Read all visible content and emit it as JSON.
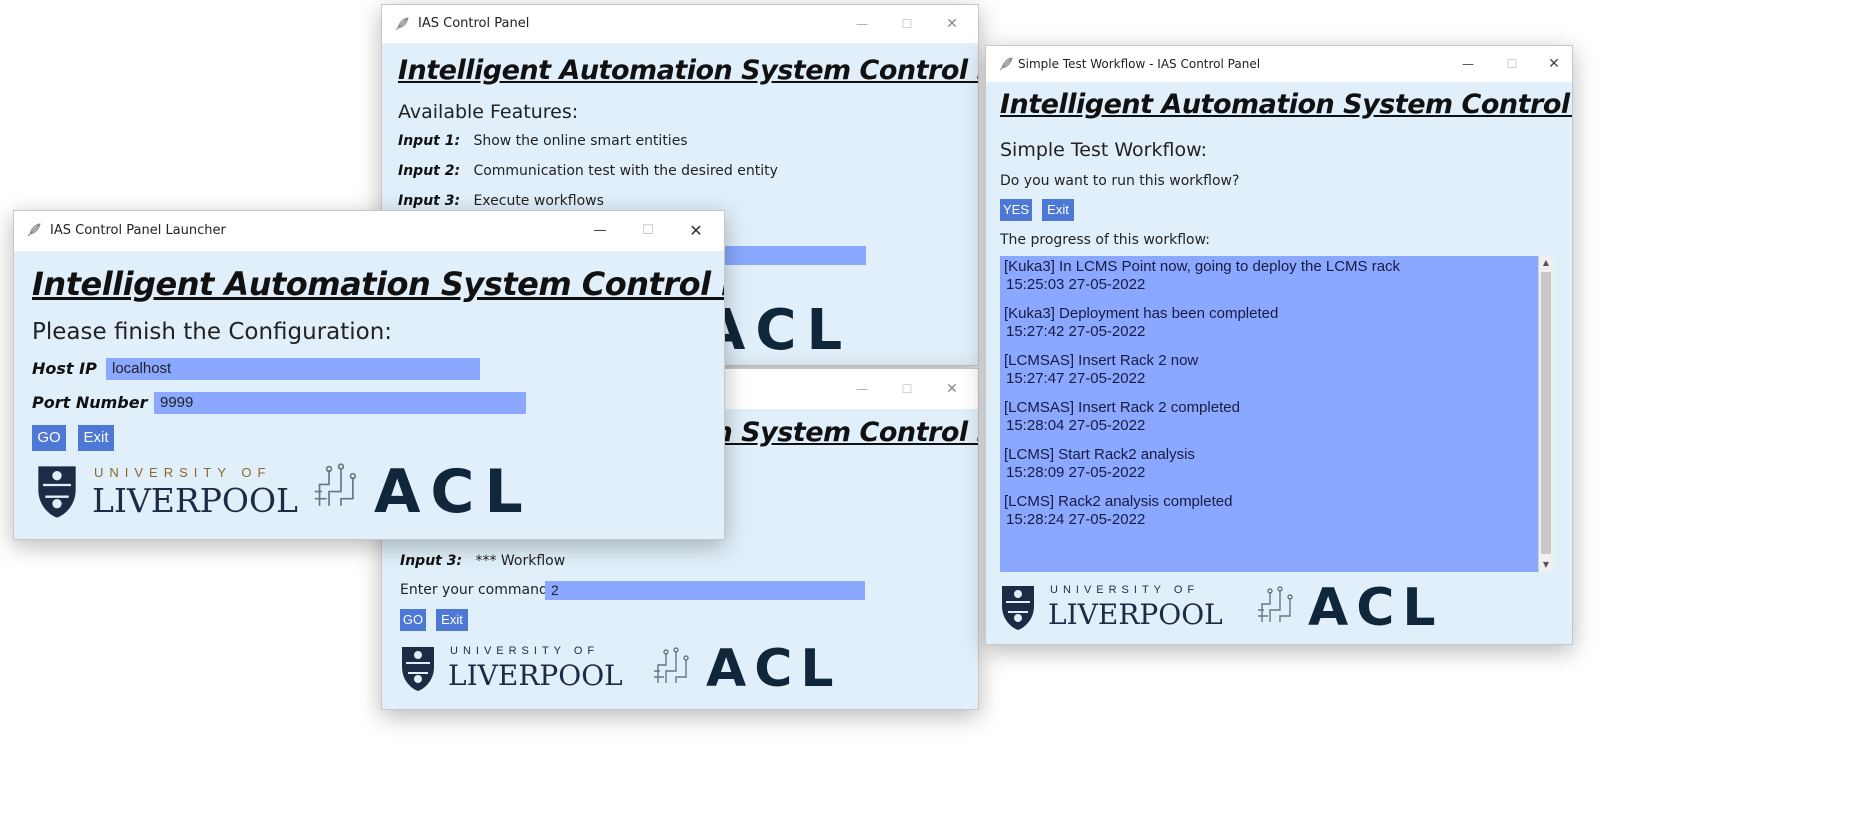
{
  "win_features": {
    "title": "IAS Control Panel",
    "heading": "Intelligent Automation System Control Panel",
    "subheading": "Available Features:",
    "items": [
      {
        "label": "Input 1:",
        "text": "Show the online smart entities"
      },
      {
        "label": "Input 2:",
        "text": "Communication test with the desired entity"
      },
      {
        "label": "Input 3:",
        "text": "Execute workflows"
      }
    ],
    "acl": "ACL"
  },
  "win_command": {
    "heading": "Intelligent Automation System Control Panel",
    "item_label": "Input 3:",
    "item_text": "*** Workflow",
    "command_label": "Enter your command",
    "command_value": "2",
    "go_label": "GO",
    "exit_label": "Exit",
    "uni_of": "UNIVERSITY OF",
    "uni_name": "LIVERPOOL",
    "acl": "ACL"
  },
  "win_launcher": {
    "title": "IAS Control Panel Launcher",
    "heading": "Intelligent Automation System Control Panel",
    "subheading": "Please finish the Configuration:",
    "host_label": "Host IP",
    "host_value": "localhost",
    "port_label": "Port Number",
    "port_value": "9999",
    "go_label": "GO",
    "exit_label": "Exit",
    "uni_of": "UNIVERSITY OF",
    "uni_name": "LIVERPOOL",
    "acl": "ACL"
  },
  "win_workflow": {
    "title": "Simple Test Workflow - IAS Control Panel",
    "heading": "Intelligent Automation System Control Panel",
    "subheading": "Simple Test Workflow:",
    "question": "Do you want to run this workflow?",
    "yes_label": "YES",
    "exit_label": "Exit",
    "progress_label": "The progress of this workflow:",
    "log": [
      {
        "msg": "[Kuka3] In LCMS Point now, going to deploy the LCMS rack",
        "time": "15:25:03 27-05-2022"
      },
      {
        "msg": "[Kuka3] Deployment has been completed",
        "time": "15:27:42 27-05-2022"
      },
      {
        "msg": "[LCMSAS] Insert Rack 2 now",
        "time": "15:27:47 27-05-2022"
      },
      {
        "msg": "[LCMSAS] Insert Rack 2 completed",
        "time": "15:28:04 27-05-2022"
      },
      {
        "msg": "[LCMS] Start Rack2 analysis",
        "time": "15:28:09 27-05-2022"
      },
      {
        "msg": "[LCMS] Rack2 analysis completed",
        "time": "15:28:24 27-05-2022"
      }
    ],
    "uni_of": "UNIVERSITY OF",
    "uni_name": "LIVERPOOL",
    "acl": "ACL"
  },
  "window_controls": {
    "minimize": "—",
    "maximize": "☐",
    "close": "✕"
  },
  "colors": {
    "window_bg": "#e1effa",
    "field_bg": "#8aa8ff",
    "button_bg": "#4d78d6",
    "logo_navy": "#1d2b45"
  },
  "icons": [
    "feather-app-icon",
    "liverpool-crest-icon",
    "acl-circuit-icon"
  ]
}
